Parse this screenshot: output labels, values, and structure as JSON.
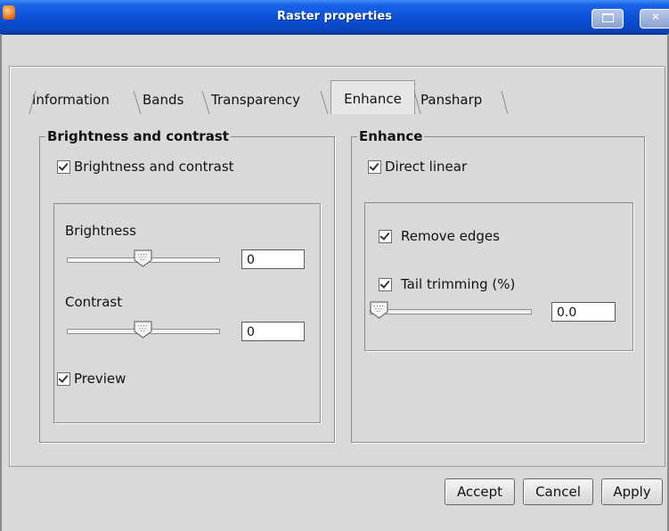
{
  "window": {
    "title": "Raster properties"
  },
  "tabs": [
    {
      "label": "Information",
      "active": false
    },
    {
      "label": "Bands",
      "active": false
    },
    {
      "label": "Transparency",
      "active": false
    },
    {
      "label": "Enhance",
      "active": true
    },
    {
      "label": "Pansharp",
      "active": false
    }
  ],
  "brightness_group": {
    "title": "Brightness and contrast",
    "enable_label": "Brightness and contrast",
    "enable_checked": true,
    "brightness_label": "Brightness",
    "brightness_value": "0",
    "brightness_level": 0.5,
    "contrast_label": "Contrast",
    "contrast_value": "0",
    "contrast_level": 0.5,
    "preview_label": "Preview",
    "preview_checked": true
  },
  "enhance_group": {
    "title": "Enhance",
    "direct_linear_label": "Direct linear",
    "direct_linear_checked": true,
    "remove_edges_label": "Remove edges",
    "remove_edges_checked": true,
    "tail_trimming_label": "Tail trimming (%)",
    "tail_trimming_checked": true,
    "tail_trimming_value": "0.0",
    "tail_trimming_level": 0.0
  },
  "buttons": {
    "accept": "Accept",
    "cancel": "Cancel",
    "apply": "Apply"
  },
  "colors": {
    "titlebar": "#0b50d6",
    "background": "#d9d9d9"
  }
}
